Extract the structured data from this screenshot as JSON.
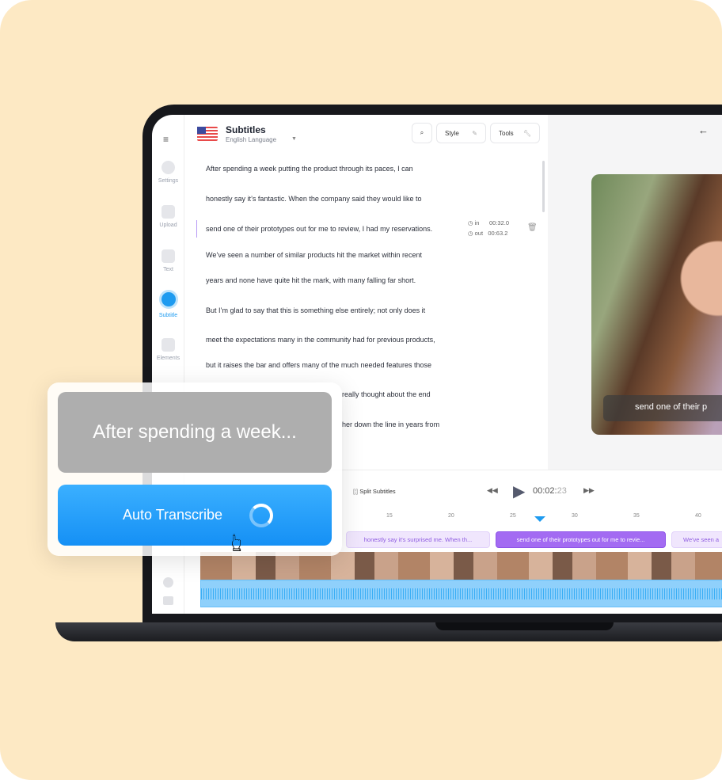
{
  "sidebar": {
    "items": [
      {
        "label": "Settings"
      },
      {
        "label": "Upload"
      },
      {
        "label": "Text"
      },
      {
        "label": "Subtitle",
        "active": true
      },
      {
        "label": "Elements"
      }
    ]
  },
  "panel": {
    "title": "Subtitles",
    "language": "English Language",
    "style_label": "Style",
    "tools_label": "Tools",
    "lines": [
      "After spending a week putting the product through its paces, I can",
      "honestly say it’s fantastic. When the company said they would like to",
      "send one of their prototypes out for me to review, I had my reservations.",
      "We’ve seen a number of similar products hit the market within recent",
      "years and none have quite hit the mark, with many falling far short.",
      "But I’m glad to say that this is something else entirely; not only does it",
      "meet the expectations many in the community had for previous products,",
      "but it raises the bar and offers many of the much needed features those",
      "really thought about the end",
      "her down the line in years from"
    ],
    "in_label": "in",
    "in_time": "00:32.0",
    "out_label": "out",
    "out_time": "00:63.2"
  },
  "preview": {
    "caption": "send one of their p"
  },
  "timeline": {
    "split_label": "Split Subtitles",
    "time_main": "00:02:",
    "time_frames": "23",
    "ticks": [
      "15",
      "20",
      "25",
      "30",
      "35",
      "40"
    ],
    "clips": [
      "honestly say it's surprised me. When th...",
      "send one of their prototypes out for me to revie...",
      "We've seen a"
    ]
  },
  "overlay": {
    "preview_text": "After spending a week...",
    "button_label": "Auto Transcribe"
  },
  "colors": {
    "background": "#fde9c4",
    "accent": "#1e9bf0",
    "clip_active": "#a36bf2"
  }
}
